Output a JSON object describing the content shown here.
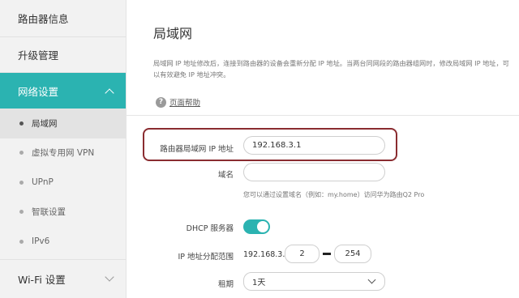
{
  "sidebar": {
    "router_info": "路由器信息",
    "upgrade": "升级管理",
    "network_settings": "网络设置",
    "sub_items": [
      {
        "label": "局域网",
        "active": true
      },
      {
        "label": "虚拟专用网 VPN",
        "active": false
      },
      {
        "label": "UPnP",
        "active": false
      },
      {
        "label": "智联设置",
        "active": false
      },
      {
        "label": "IPv6",
        "active": false
      }
    ],
    "wifi_settings": "Wi-Fi 设置"
  },
  "main": {
    "title": "局域网",
    "description": "局域网 IP 地址修改后，连接到路由器的设备会重新分配 IP 地址。当两台同网段的路由器组网时，修改局域网 IP 地址，可以有效避免 IP 地址冲突。",
    "help_link": "页面帮助",
    "lan_ip_label": "路由器局域网 IP 地址",
    "lan_ip_value": "192.168.3.1",
    "domain_label": "域名",
    "domain_value": "",
    "domain_hint": "您可以通过设置域名（例如：my.home）访问华为路由Q2 Pro",
    "dhcp_label": "DHCP 服务器",
    "dhcp_enabled": true,
    "range_label": "IP 地址分配范围",
    "range_prefix": "192.168.3.",
    "range_start": "2",
    "range_end": "254",
    "lease_label": "租期",
    "lease_value": "1天"
  },
  "colors": {
    "accent": "#2bb3b1",
    "highlight_border": "#8a2c30"
  },
  "icons": {
    "help": "help-circle-icon",
    "nav_expanded": "chevron-up-icon",
    "nav_collapsed": "chevron-down-icon",
    "select": "chevron-down-icon"
  }
}
